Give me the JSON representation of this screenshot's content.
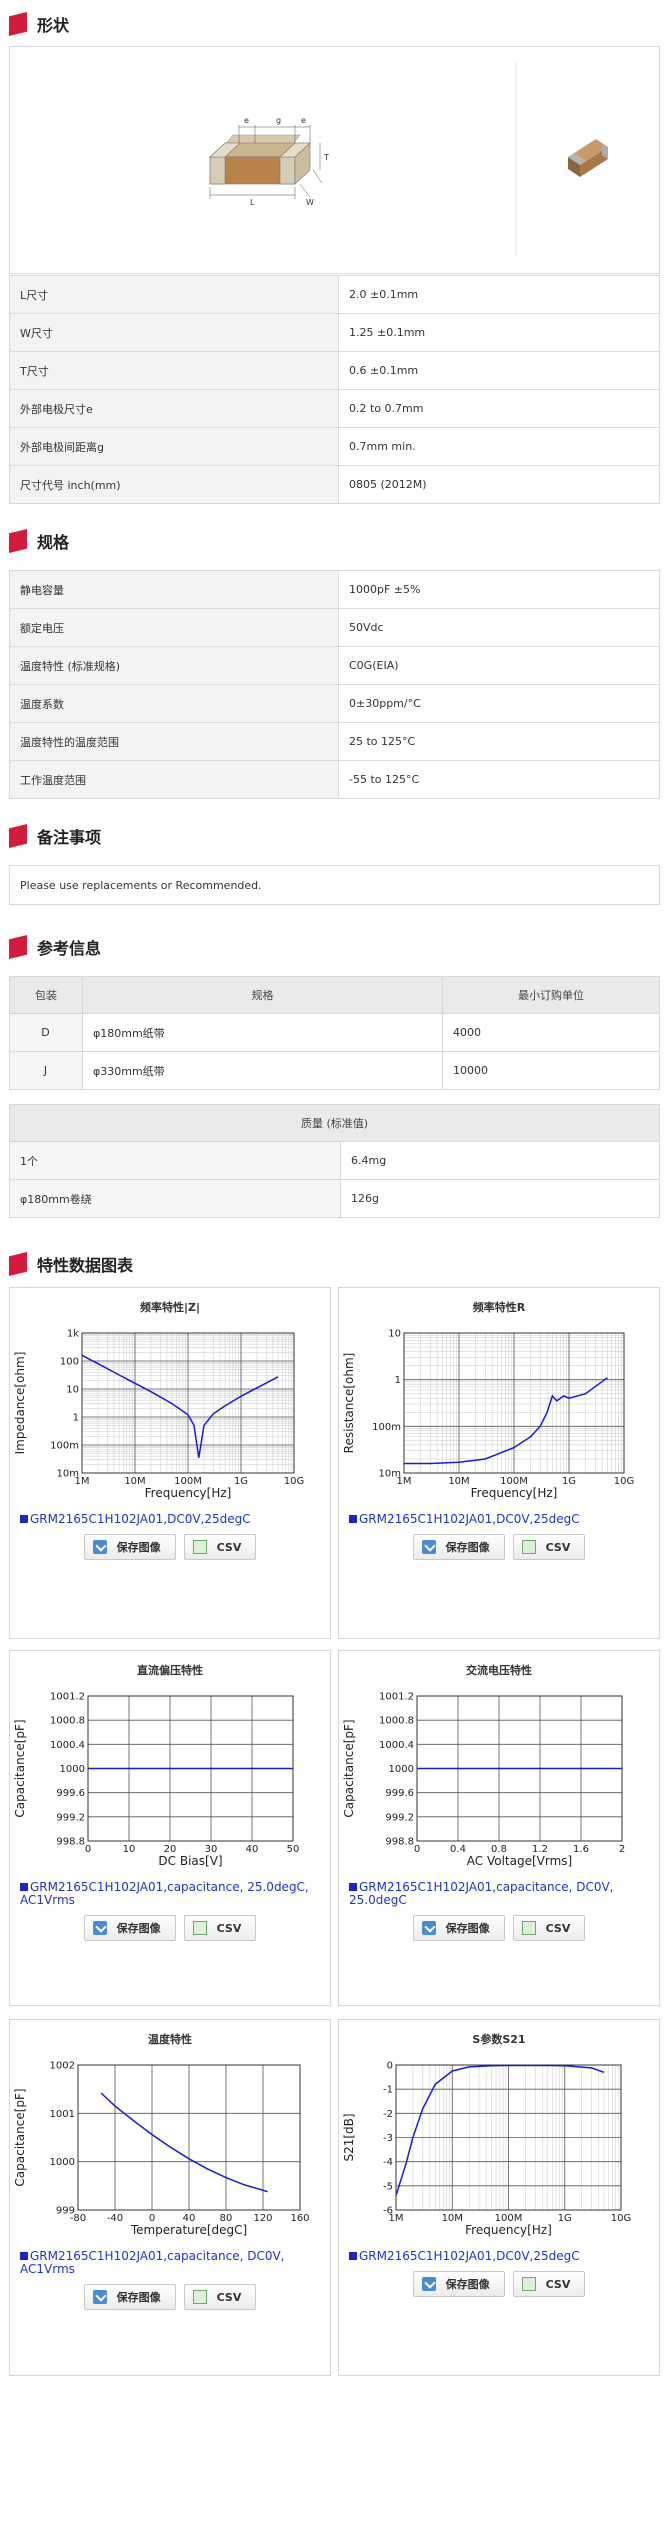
{
  "sections": {
    "shape": "形状",
    "spec": "规格",
    "notes": "备注事项",
    "reference": "参考信息",
    "charts": "特性数据图表"
  },
  "dimension_labels": {
    "e1": "e",
    "g": "g",
    "e2": "e",
    "T": "T",
    "L": "L",
    "W": "W"
  },
  "shape_rows": [
    {
      "k": "L尺寸",
      "v": "2.0 ±0.1mm"
    },
    {
      "k": "W尺寸",
      "v": "1.25 ±0.1mm"
    },
    {
      "k": "T尺寸",
      "v": "0.6 ±0.1mm"
    },
    {
      "k": "外部电极尺寸e",
      "v": "0.2 to 0.7mm"
    },
    {
      "k": "外部电极间距离g",
      "v": "0.7mm min."
    },
    {
      "k": "尺寸代号 inch(mm)",
      "v": "0805 (2012M)"
    }
  ],
  "spec_rows": [
    {
      "k": "静电容量",
      "v": "1000pF ±5%"
    },
    {
      "k": "额定电压",
      "v": "50Vdc"
    },
    {
      "k": "温度特性 (标准规格)",
      "v": "C0G(EIA)"
    },
    {
      "k": "温度系数",
      "v": "0±30ppm/°C"
    },
    {
      "k": "温度特性的温度范围",
      "v": "25 to 125°C"
    },
    {
      "k": "工作温度范围",
      "v": "-55 to 125°C"
    }
  ],
  "notes_text": "Please use replacements or Recommended.",
  "packaging": {
    "headers": [
      "包装",
      "规格",
      "最小订购单位"
    ],
    "rows": [
      [
        "D",
        "φ180mm纸带",
        "4000"
      ],
      [
        "J",
        "φ330mm纸带",
        "10000"
      ]
    ]
  },
  "mass": {
    "header": "质量 (标准值)",
    "rows": [
      [
        "1个",
        "6.4mg"
      ],
      [
        "φ180mm卷绕",
        "126g"
      ]
    ]
  },
  "buttons": {
    "save": "保存图像",
    "csv": "CSV"
  },
  "colors": {
    "accent": "#d61a3c",
    "curve": "#1a1ad8",
    "legend": "#2233cc"
  },
  "chart_data": [
    {
      "type": "line",
      "title": "频率特性|Z|",
      "xlabel": "Frequency[Hz]",
      "ylabel": "Impedance[ohm]",
      "x_scale": "log",
      "y_scale": "log",
      "xticks": [
        "1M",
        "10M",
        "100M",
        "1G",
        "10G"
      ],
      "yticks": [
        "1k",
        "100",
        "10",
        "1",
        "100m",
        "10m"
      ],
      "xlim": [
        1000000,
        10000000000
      ],
      "ylim": [
        0.01,
        1000
      ],
      "legend": "GRM2165C1H102JA01,DC0V,25degC",
      "series": [
        {
          "x": [
            1000000,
            2000000,
            5000000,
            10000000,
            20000000,
            50000000,
            100000000,
            130000000,
            160000000,
            200000000,
            300000000,
            500000000,
            1000000000,
            2000000000,
            5000000000
          ],
          "y": [
            160,
            80,
            32,
            16,
            8,
            3,
            1.2,
            0.5,
            0.035,
            0.5,
            1.3,
            2.5,
            5.5,
            11,
            27
          ]
        }
      ]
    },
    {
      "type": "line",
      "title": "频率特性R",
      "xlabel": "Frequency[Hz]",
      "ylabel": "Resistance[ohm]",
      "x_scale": "log",
      "y_scale": "log",
      "xticks": [
        "1M",
        "10M",
        "100M",
        "1G",
        "10G"
      ],
      "yticks": [
        "10",
        "1",
        "100m",
        "10m"
      ],
      "xlim": [
        1000000,
        10000000000
      ],
      "ylim": [
        0.01,
        10
      ],
      "legend": "GRM2165C1H102JA01,DC0V,25degC",
      "series": [
        {
          "x": [
            1000000,
            3000000,
            10000000,
            30000000,
            100000000,
            200000000,
            300000000,
            400000000,
            500000000,
            600000000,
            800000000,
            1000000000,
            2000000000,
            5000000000
          ],
          "y": [
            0.016,
            0.016,
            0.017,
            0.02,
            0.035,
            0.06,
            0.1,
            0.2,
            0.45,
            0.35,
            0.45,
            0.4,
            0.5,
            1.1
          ]
        }
      ]
    },
    {
      "type": "line",
      "title": "直流偏压特性",
      "xlabel": "DC Bias[V]",
      "ylabel": "Capacitance[pF]",
      "xticks": [
        "0",
        "10",
        "20",
        "30",
        "40",
        "50"
      ],
      "yticks": [
        "1001.2",
        "1000.8",
        "1000.4",
        "1000",
        "999.6",
        "999.2",
        "998.8"
      ],
      "xlim": [
        0,
        50
      ],
      "ylim": [
        998.8,
        1001.2
      ],
      "legend": "GRM2165C1H102JA01,capacitance, 25.0degC, AC1Vrms",
      "series": [
        {
          "x": [
            0,
            50
          ],
          "y": [
            1000,
            1000
          ]
        }
      ]
    },
    {
      "type": "line",
      "title": "交流电压特性",
      "xlabel": "AC Voltage[Vrms]",
      "ylabel": "Capacitance[pF]",
      "xticks": [
        "0",
        "0.4",
        "0.8",
        "1.2",
        "1.6",
        "2"
      ],
      "yticks": [
        "1001.2",
        "1000.8",
        "1000.4",
        "1000",
        "999.6",
        "999.2",
        "998.8"
      ],
      "xlim": [
        0,
        2
      ],
      "ylim": [
        998.8,
        1001.2
      ],
      "legend": "GRM2165C1H102JA01,capacitance, DC0V, 25.0degC",
      "series": [
        {
          "x": [
            0,
            2
          ],
          "y": [
            1000,
            1000
          ]
        }
      ]
    },
    {
      "type": "line",
      "title": "温度特性",
      "xlabel": "Temperature[degC]",
      "ylabel": "Capacitance[pF]",
      "xticks": [
        "-80",
        "-40",
        "0",
        "40",
        "80",
        "120",
        "160"
      ],
      "yticks": [
        "1002",
        "1001",
        "1000",
        "999"
      ],
      "xlim": [
        -80,
        160
      ],
      "ylim": [
        999,
        1002
      ],
      "legend": "GRM2165C1H102JA01,capacitance, DC0V, AC1Vrms",
      "series": [
        {
          "x": [
            -55,
            -40,
            -20,
            0,
            20,
            40,
            60,
            80,
            100,
            125
          ],
          "y": [
            1001.42,
            1001.15,
            1000.85,
            1000.56,
            1000.3,
            1000.06,
            999.85,
            999.67,
            999.52,
            999.38
          ]
        }
      ]
    },
    {
      "type": "line",
      "title": "S参数S21",
      "xlabel": "Frequency[Hz]",
      "ylabel": "S21[dB]",
      "x_scale": "log",
      "xticks": [
        "1M",
        "10M",
        "100M",
        "1G",
        "10G"
      ],
      "yticks": [
        "0",
        "-1",
        "-2",
        "-3",
        "-4",
        "-5",
        "-6"
      ],
      "xlim": [
        1000000,
        10000000000
      ],
      "ylim": [
        -6,
        0
      ],
      "legend": "GRM2165C1H102JA01,DC0V,25degC",
      "series": [
        {
          "x": [
            1000000,
            1500000,
            2000000,
            3000000,
            5000000,
            10000000,
            20000000,
            50000000,
            100000000,
            500000000,
            1000000000,
            3000000000,
            5000000000
          ],
          "y": [
            -5.4,
            -4.1,
            -3.0,
            -1.8,
            -0.8,
            -0.25,
            -0.08,
            -0.03,
            -0.02,
            -0.02,
            -0.03,
            -0.12,
            -0.3
          ]
        }
      ]
    }
  ]
}
